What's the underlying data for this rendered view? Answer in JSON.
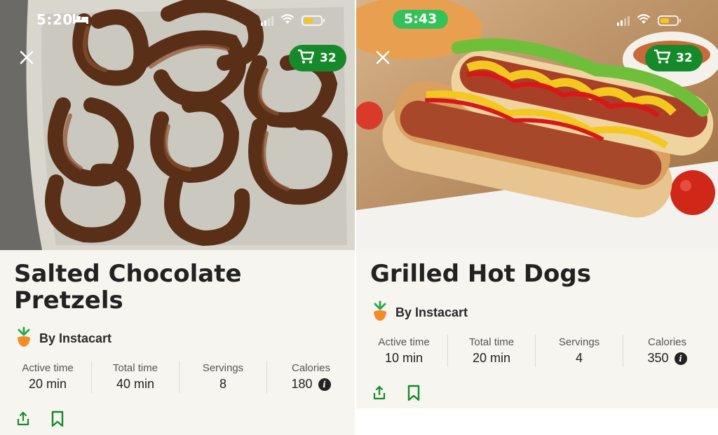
{
  "left": {
    "status": {
      "time": "5:20"
    },
    "cart": {
      "count": "32"
    },
    "recipe": {
      "title": "Salted Chocolate Pretzels",
      "author": "By Instacart",
      "stats": [
        {
          "label": "Active time",
          "value": "20 min"
        },
        {
          "label": "Total time",
          "value": "40 min"
        },
        {
          "label": "Servings",
          "value": "8"
        },
        {
          "label": "Calories",
          "value": "180",
          "info": true
        }
      ]
    }
  },
  "right": {
    "status": {
      "time": "5:43"
    },
    "cart": {
      "count": "32"
    },
    "recipe": {
      "title": "Grilled Hot Dogs",
      "author": "By Instacart",
      "stats": [
        {
          "label": "Active time",
          "value": "10 min"
        },
        {
          "label": "Total time",
          "value": "20 min"
        },
        {
          "label": "Servings",
          "value": "4"
        },
        {
          "label": "Calories",
          "value": "350",
          "info": true
        }
      ]
    }
  },
  "colors": {
    "accent": "#168a2a",
    "background": "#f6f5ef",
    "status_pill": "#35c15a",
    "battery": "#f5c518"
  },
  "icons": {
    "close": "close-icon",
    "cart": "cart-icon",
    "share": "share-icon",
    "bookmark": "bookmark-icon",
    "info": "info-icon",
    "logo": "instacart-carrot-icon"
  }
}
